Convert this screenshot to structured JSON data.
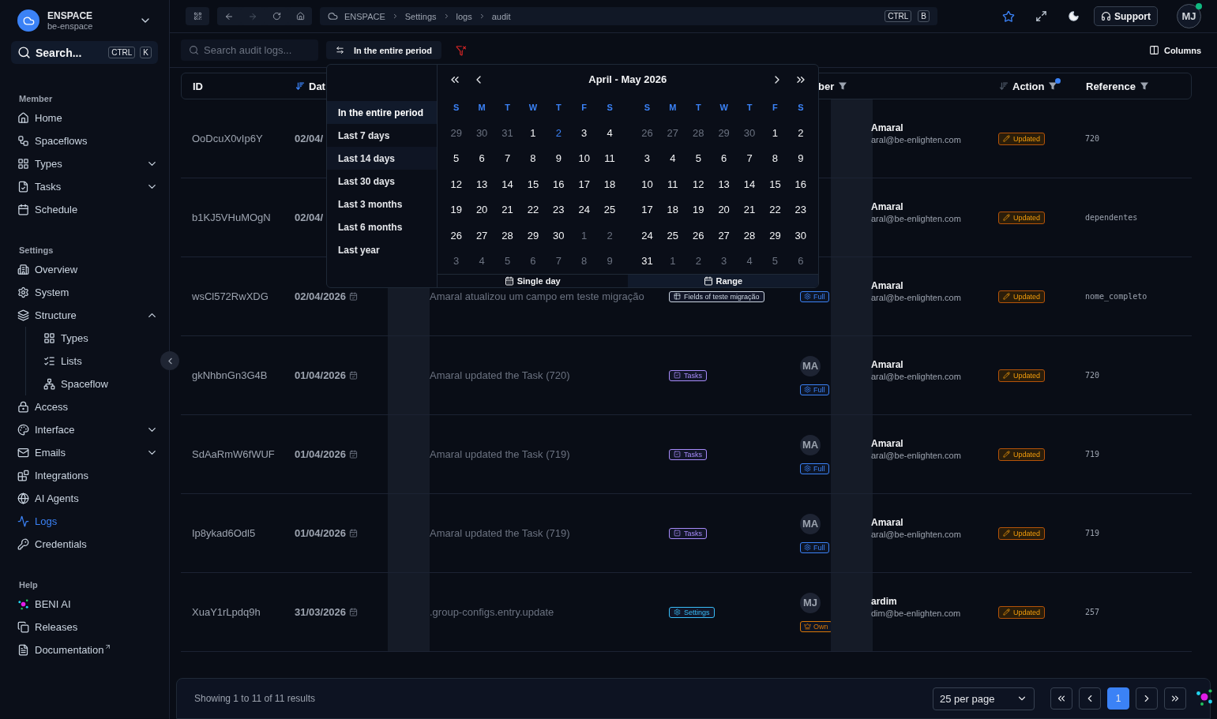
{
  "workspace": {
    "name": "ENSPACE",
    "slug": "be-enspace"
  },
  "sidebar_search": {
    "label": "Search...",
    "keys": [
      "CTRL",
      "K"
    ]
  },
  "sidebar": [
    {
      "heading": "Member",
      "items": [
        {
          "label": "Home",
          "kind": "link",
          "selected": false
        },
        {
          "label": "Spaceflows",
          "kind": "link",
          "selected": false
        },
        {
          "label": "Types",
          "kind": "group",
          "expanded": false,
          "selected": false
        },
        {
          "label": "Tasks",
          "kind": "group",
          "expanded": false,
          "selected": false
        },
        {
          "label": "Schedule",
          "kind": "link",
          "selected": false
        }
      ]
    },
    {
      "heading": "Settings",
      "items": [
        {
          "label": "Overview",
          "kind": "link",
          "selected": false
        },
        {
          "label": "System",
          "kind": "link",
          "selected": false
        },
        {
          "label": "Structure",
          "kind": "group",
          "expanded": true,
          "selected": false,
          "children": [
            {
              "label": "Types",
              "kind": "link",
              "selected": false
            },
            {
              "label": "Lists",
              "kind": "link",
              "selected": false
            },
            {
              "label": "Spaceflow",
              "kind": "link",
              "selected": false
            }
          ]
        },
        {
          "label": "Access",
          "kind": "link",
          "selected": false
        },
        {
          "label": "Interface",
          "kind": "group",
          "expanded": false,
          "selected": false
        },
        {
          "label": "Emails",
          "kind": "group",
          "expanded": false,
          "selected": false
        },
        {
          "label": "Integrations",
          "kind": "link",
          "selected": false
        },
        {
          "label": "AI Agents",
          "kind": "link",
          "selected": false
        },
        {
          "label": "Logs",
          "kind": "link",
          "selected": true
        },
        {
          "label": "Credentials",
          "kind": "link",
          "selected": false
        }
      ]
    },
    {
      "heading": "Help",
      "items": [
        {
          "label": "BENI AI",
          "kind": "link",
          "selected": false
        },
        {
          "label": "Releases",
          "kind": "link",
          "selected": false
        },
        {
          "label": "Documentation",
          "kind": "external",
          "selected": false
        }
      ]
    }
  ],
  "breadcrumb": [
    "ENSPACE",
    "Settings",
    "logs",
    "audit"
  ],
  "breadcrumb_keys": [
    "CTRL",
    "B"
  ],
  "support_button": "Support",
  "user_avatar": {
    "initials": "MJ",
    "online": true
  },
  "search": {
    "placeholder": "Search audit logs..."
  },
  "period_button": "In the entire period",
  "columns_button": "Columns",
  "table": {
    "headers": [
      {
        "label": "ID"
      },
      {
        "label": "Dat",
        "sort": true,
        "sort_active": true
      },
      {
        "label": "ber",
        "filter": true,
        "filter_active": false
      },
      {
        "label": "Action",
        "sort": true,
        "sort_active": false,
        "filter": true,
        "filter_active": true
      },
      {
        "label": "Reference",
        "filter": true,
        "filter_active": false
      }
    ],
    "rows": [
      {
        "id": "OoDcuX0vIp6Y",
        "date": "02/04/",
        "user": {
          "name": "Amaral",
          "email": "aral@be-enlighten.com"
        },
        "action": "Updated",
        "reference": "720"
      },
      {
        "id": "b1KJ5VHuMOgN",
        "date": "02/04/",
        "user": {
          "name": "Amaral",
          "email": "aral@be-enlighten.com"
        },
        "action": "Updated",
        "reference": "dependentes"
      },
      {
        "id": "wsCl572RwXDG",
        "date": "02/04/2026",
        "description": "Amaral atualizou um campo em teste migração",
        "module": {
          "label": "Fields of teste migração",
          "kind": "fields",
          "color": "#cbd5e1"
        },
        "user": {
          "name": "Amaral",
          "email": "aral@be-enlighten.com",
          "permission": {
            "label": "Full",
            "kind": "full"
          }
        },
        "action": "Updated",
        "reference": "nome_completo"
      },
      {
        "id": "gkNhbnGn3G4B",
        "date": "01/04/2026",
        "description": "Amaral updated the Task (720)",
        "module": {
          "label": "Tasks",
          "kind": "tasks",
          "color": "#a78bfa"
        },
        "user": {
          "initials": "MA",
          "name": "Amaral",
          "email": "aral@be-enlighten.com",
          "permission": {
            "label": "Full",
            "kind": "full"
          }
        },
        "action": "Updated",
        "reference": "720"
      },
      {
        "id": "SdAaRmW6fWUF",
        "date": "01/04/2026",
        "description": "Amaral updated the Task (719)",
        "module": {
          "label": "Tasks",
          "kind": "tasks",
          "color": "#a78bfa"
        },
        "user": {
          "initials": "MA",
          "name": "Amaral",
          "email": "aral@be-enlighten.com",
          "permission": {
            "label": "Full",
            "kind": "full"
          }
        },
        "action": "Updated",
        "reference": "719"
      },
      {
        "id": "Ip8ykad6Odl5",
        "date": "01/04/2026",
        "description": "Amaral updated the Task (719)",
        "module": {
          "label": "Tasks",
          "kind": "tasks",
          "color": "#a78bfa"
        },
        "user": {
          "initials": "MA",
          "name": "Amaral",
          "email": "aral@be-enlighten.com",
          "permission": {
            "label": "Full",
            "kind": "full"
          }
        },
        "action": "Updated",
        "reference": "719"
      },
      {
        "id": "XuaY1rLpdq9h",
        "date": "31/03/2026",
        "description": ".group-configs.entry.update",
        "module": {
          "label": "Settings",
          "kind": "settings",
          "color": "#38bdf8"
        },
        "user": {
          "initials": "MJ",
          "name": "ardim",
          "email": "dim@be-enlighten.com",
          "permission": {
            "label": "Own",
            "kind": "owner"
          }
        },
        "action": "Updated",
        "reference": "257"
      }
    ]
  },
  "date_picker": {
    "presets": [
      {
        "label": "In the entire period",
        "selected": true,
        "hovered": false
      },
      {
        "label": "Last 7 days",
        "selected": false,
        "hovered": false
      },
      {
        "label": "Last 14 days",
        "selected": false,
        "hovered": true
      },
      {
        "label": "Last 30 days",
        "selected": false,
        "hovered": false
      },
      {
        "label": "Last 3 months",
        "selected": false,
        "hovered": false
      },
      {
        "label": "Last 6 months",
        "selected": false,
        "hovered": false
      },
      {
        "label": "Last year",
        "selected": false,
        "hovered": false
      }
    ],
    "title": "April - May 2026",
    "months": [
      {
        "weekdays": [
          "S",
          "M",
          "T",
          "W",
          "T",
          "F",
          "S"
        ],
        "weeks": [
          [
            {
              "day": "29",
              "outside": true,
              "today": false
            },
            {
              "day": "30",
              "outside": true,
              "today": false
            },
            {
              "day": "31",
              "outside": true,
              "today": false
            },
            {
              "day": "1",
              "outside": false,
              "today": false
            },
            {
              "day": "2",
              "outside": false,
              "today": true
            },
            {
              "day": "3",
              "outside": false,
              "today": false
            },
            {
              "day": "4",
              "outside": false,
              "today": false
            }
          ],
          [
            {
              "day": "5",
              "outside": false,
              "today": false
            },
            {
              "day": "6",
              "outside": false,
              "today": false
            },
            {
              "day": "7",
              "outside": false,
              "today": false
            },
            {
              "day": "8",
              "outside": false,
              "today": false
            },
            {
              "day": "9",
              "outside": false,
              "today": false
            },
            {
              "day": "10",
              "outside": false,
              "today": false
            },
            {
              "day": "11",
              "outside": false,
              "today": false
            }
          ],
          [
            {
              "day": "12",
              "outside": false,
              "today": false
            },
            {
              "day": "13",
              "outside": false,
              "today": false
            },
            {
              "day": "14",
              "outside": false,
              "today": false
            },
            {
              "day": "15",
              "outside": false,
              "today": false
            },
            {
              "day": "16",
              "outside": false,
              "today": false
            },
            {
              "day": "17",
              "outside": false,
              "today": false
            },
            {
              "day": "18",
              "outside": false,
              "today": false
            }
          ],
          [
            {
              "day": "19",
              "outside": false,
              "today": false
            },
            {
              "day": "20",
              "outside": false,
              "today": false
            },
            {
              "day": "21",
              "outside": false,
              "today": false
            },
            {
              "day": "22",
              "outside": false,
              "today": false
            },
            {
              "day": "23",
              "outside": false,
              "today": false
            },
            {
              "day": "24",
              "outside": false,
              "today": false
            },
            {
              "day": "25",
              "outside": false,
              "today": false
            }
          ],
          [
            {
              "day": "26",
              "outside": false,
              "today": false
            },
            {
              "day": "27",
              "outside": false,
              "today": false
            },
            {
              "day": "28",
              "outside": false,
              "today": false
            },
            {
              "day": "29",
              "outside": false,
              "today": false
            },
            {
              "day": "30",
              "outside": false,
              "today": false
            },
            {
              "day": "1",
              "outside": true,
              "today": false
            },
            {
              "day": "2",
              "outside": true,
              "today": false
            }
          ],
          [
            {
              "day": "3",
              "outside": true,
              "today": false
            },
            {
              "day": "4",
              "outside": true,
              "today": false
            },
            {
              "day": "5",
              "outside": true,
              "today": false
            },
            {
              "day": "6",
              "outside": true,
              "today": false
            },
            {
              "day": "7",
              "outside": true,
              "today": false
            },
            {
              "day": "8",
              "outside": true,
              "today": false
            },
            {
              "day": "9",
              "outside": true,
              "today": false
            }
          ]
        ]
      },
      {
        "weekdays": [
          "S",
          "M",
          "T",
          "W",
          "T",
          "F",
          "S"
        ],
        "weeks": [
          [
            {
              "day": "26",
              "outside": true,
              "today": false
            },
            {
              "day": "27",
              "outside": true,
              "today": false
            },
            {
              "day": "28",
              "outside": true,
              "today": false
            },
            {
              "day": "29",
              "outside": true,
              "today": false
            },
            {
              "day": "30",
              "outside": true,
              "today": false
            },
            {
              "day": "1",
              "outside": false,
              "today": false
            },
            {
              "day": "2",
              "outside": false,
              "today": false
            }
          ],
          [
            {
              "day": "3",
              "outside": false,
              "today": false
            },
            {
              "day": "4",
              "outside": false,
              "today": false
            },
            {
              "day": "5",
              "outside": false,
              "today": false
            },
            {
              "day": "6",
              "outside": false,
              "today": false
            },
            {
              "day": "7",
              "outside": false,
              "today": false
            },
            {
              "day": "8",
              "outside": false,
              "today": false
            },
            {
              "day": "9",
              "outside": false,
              "today": false
            }
          ],
          [
            {
              "day": "10",
              "outside": false,
              "today": false
            },
            {
              "day": "11",
              "outside": false,
              "today": false
            },
            {
              "day": "12",
              "outside": false,
              "today": false
            },
            {
              "day": "13",
              "outside": false,
              "today": false
            },
            {
              "day": "14",
              "outside": false,
              "today": false
            },
            {
              "day": "15",
              "outside": false,
              "today": false
            },
            {
              "day": "16",
              "outside": false,
              "today": false
            }
          ],
          [
            {
              "day": "17",
              "outside": false,
              "today": false
            },
            {
              "day": "18",
              "outside": false,
              "today": false
            },
            {
              "day": "19",
              "outside": false,
              "today": false
            },
            {
              "day": "20",
              "outside": false,
              "today": false
            },
            {
              "day": "21",
              "outside": false,
              "today": false
            },
            {
              "day": "22",
              "outside": false,
              "today": false
            },
            {
              "day": "23",
              "outside": false,
              "today": false
            }
          ],
          [
            {
              "day": "24",
              "outside": false,
              "today": false
            },
            {
              "day": "25",
              "outside": false,
              "today": false
            },
            {
              "day": "26",
              "outside": false,
              "today": false
            },
            {
              "day": "27",
              "outside": false,
              "today": false
            },
            {
              "day": "28",
              "outside": false,
              "today": false
            },
            {
              "day": "29",
              "outside": false,
              "today": false
            },
            {
              "day": "30",
              "outside": false,
              "today": false
            }
          ],
          [
            {
              "day": "31",
              "outside": false,
              "today": false
            },
            {
              "day": "1",
              "outside": true,
              "today": false
            },
            {
              "day": "2",
              "outside": true,
              "today": false
            },
            {
              "day": "3",
              "outside": true,
              "today": false
            },
            {
              "day": "4",
              "outside": true,
              "today": false
            },
            {
              "day": "5",
              "outside": true,
              "today": false
            },
            {
              "day": "6",
              "outside": true,
              "today": false
            }
          ]
        ]
      }
    ],
    "modes": [
      {
        "label": "Single day",
        "selected": false
      },
      {
        "label": "Range",
        "selected": true
      }
    ]
  },
  "footer": {
    "summary": "Showing 1 to 11 of 11 results",
    "page_size": "25 per page",
    "pages": [
      {
        "label": "1",
        "selected": true
      }
    ]
  }
}
